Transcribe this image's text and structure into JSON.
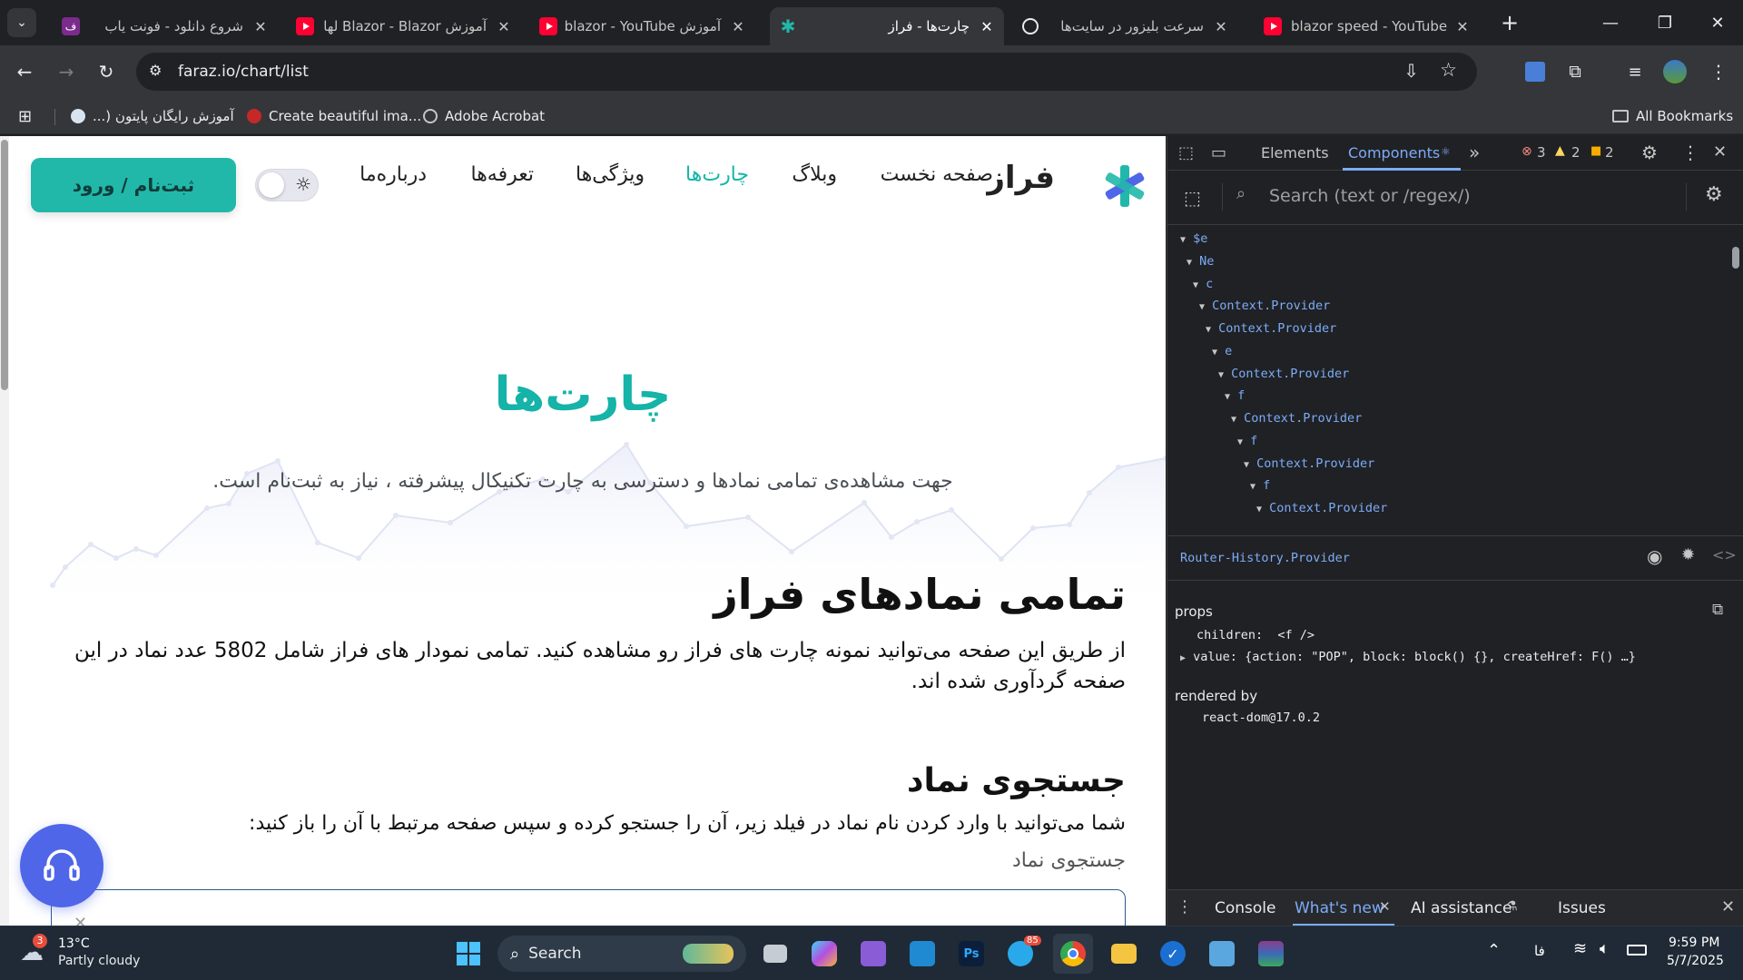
{
  "browser": {
    "tabs": [
      {
        "title": "شروع دانلود - فونت یاب",
        "icon": "fontyab-favicon"
      },
      {
        "title": "آموزش Blazor - Blazor لها",
        "icon": "youtube-icon"
      },
      {
        "title": "آموزش blazor - YouTube",
        "icon": "youtube-icon"
      },
      {
        "title": "چارت‌ها - فراز",
        "icon": "faraz-favicon",
        "active": true
      },
      {
        "title": "سرعت بلیزور در سایت‌ها",
        "icon": "openai-icon"
      },
      {
        "title": "blazor speed - YouTube",
        "icon": "youtube-icon"
      }
    ],
    "url": "faraz.io/chart/list",
    "bookmarks": [
      "آموزش رایگان پایتون (...",
      "Create beautiful ima...",
      "Adobe Acrobat"
    ],
    "all_bookmarks": "All Bookmarks"
  },
  "site": {
    "logo_text": "فراز",
    "nav": [
      "صفحه نخست",
      "وبلاگ",
      "چارت‌ها",
      "ویژگی‌ها",
      "تعرفه‌ها",
      "درباره‌ما"
    ],
    "active_nav": "چارت‌ها",
    "cta": "ثبت‌نام / ورود",
    "hero_title": "چارت‌ها",
    "hero_subtitle": "جهت مشاهده‌ی تمامی نمادها و دسترسی به چارت تکنیکال پیشرفته ، نیاز به ثبت‌نام است.",
    "section_title": "تمامی نمادهای فراز",
    "section_text": "از طریق این صفحه می‌توانید نمونه چارت های فراز رو مشاهده کنید. تمامی نمودار های فراز شامل 5802 عدد نماد در این صفحه گردآوری شده اند.",
    "search_title": "جستجوی نماد",
    "search_text": "شما می‌توانید با وارد کردن نام نماد در فیلد زیر، آن را جستجو کرده و سپس صفحه مرتبط با آن را باز کنید:",
    "search_label": "جستجوی نماد",
    "accent_color": "#15b3a8"
  },
  "devtools": {
    "tabs": [
      "Elements",
      "Components"
    ],
    "active_tab": "Components",
    "errors": "3",
    "warnings": "2",
    "issues": "2",
    "search_placeholder": "Search (text or /regex/)",
    "tree": [
      "$e",
      "Ne",
      "c",
      "Context.Provider",
      "Context.Provider",
      "e",
      "Context.Provider",
      "f",
      "Context.Provider",
      "f",
      "Context.Provider",
      "f",
      "Context.Provider"
    ],
    "selected": "Router-History.Provider",
    "props_label": "props",
    "prop_children_key": "children:",
    "prop_children_val": "<f />",
    "prop_value_key": "value:",
    "prop_value_val": "{action: \"POP\", block: block() {}, createHref: F() …}",
    "rendered_by_label": "rendered by",
    "rendered_by": "react-dom@17.0.2",
    "drawer_tabs": [
      "Console",
      "What's new",
      "AI assistance",
      "Issues"
    ],
    "active_drawer": "What's new"
  },
  "taskbar": {
    "weather_temp": "13°C",
    "weather_desc": "Partly cloudy",
    "weather_badge": "3",
    "search": "Search",
    "telegram_badge": "85",
    "lang": "فا",
    "time": "9:59 PM",
    "date": "5/7/2025"
  }
}
